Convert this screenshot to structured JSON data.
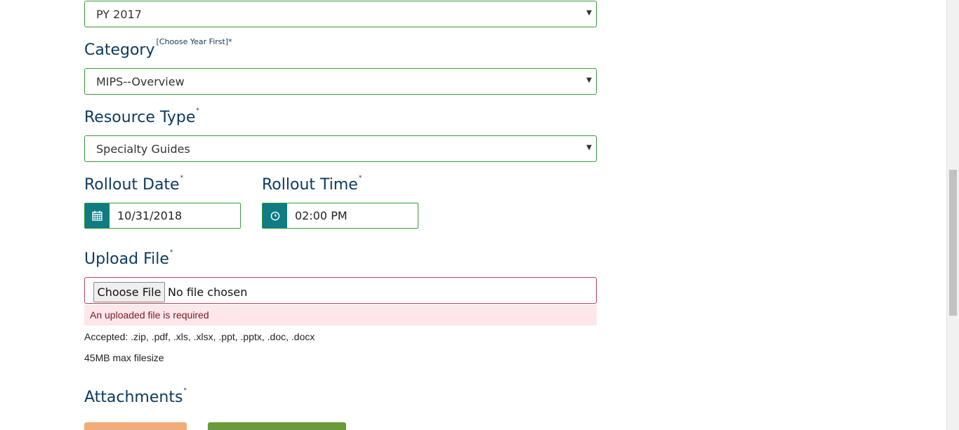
{
  "year_select": {
    "value": "PY 2017"
  },
  "category": {
    "label": "Category",
    "hint": "[Choose Year First]*",
    "value": "MIPS--Overview"
  },
  "resource_type": {
    "label": "Resource Type",
    "required": "*",
    "value": "Specialty Guides"
  },
  "rollout_date": {
    "label": "Rollout Date",
    "required": "*",
    "value": "10/31/2018",
    "icon": "calendar-icon"
  },
  "rollout_time": {
    "label": "Rollout Time",
    "required": "*",
    "value": "02:00 PM",
    "icon": "clock-icon"
  },
  "upload_file": {
    "label": "Upload File",
    "required": "*",
    "button_label": "Choose File",
    "status": "No file chosen",
    "error": "An uploaded file is required",
    "accepted": "Accepted: .zip, .pdf, .xls, .xlsx, .ppt, .pptx, .doc, .docx",
    "max_size": "45MB max filesize"
  },
  "attachments": {
    "label": "Attachments",
    "required": "*"
  },
  "colors": {
    "accent_green": "#3a9a3a",
    "addon_teal": "#0f7b82",
    "heading": "#0b3a5e",
    "error_border": "#b8425a",
    "orange_button": "#f0ad7a",
    "green_button": "#6a9a3a"
  }
}
